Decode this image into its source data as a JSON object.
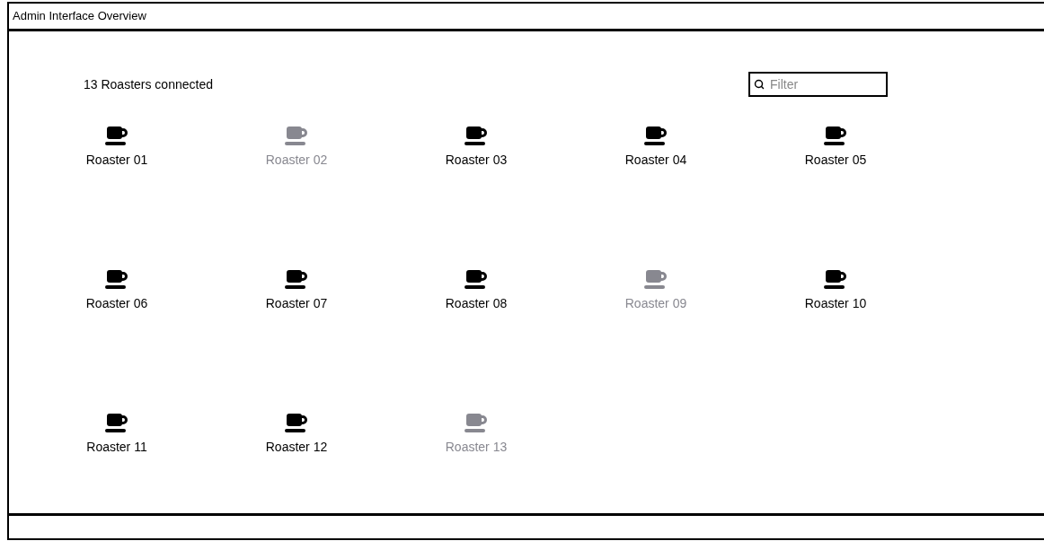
{
  "window": {
    "title": "Admin Interface Overview"
  },
  "summary": "13 Roasters connected",
  "filter": {
    "placeholder": "Filter"
  },
  "roasters": [
    {
      "name": "Roaster 01",
      "disabled": false
    },
    {
      "name": "Roaster 02",
      "disabled": true
    },
    {
      "name": "Roaster 03",
      "disabled": false
    },
    {
      "name": "Roaster 04",
      "disabled": false
    },
    {
      "name": "Roaster 05",
      "disabled": false
    },
    {
      "name": "Roaster 06",
      "disabled": false
    },
    {
      "name": "Roaster 07",
      "disabled": false
    },
    {
      "name": "Roaster 08",
      "disabled": false
    },
    {
      "name": "Roaster 09",
      "disabled": true
    },
    {
      "name": "Roaster 10",
      "disabled": false
    },
    {
      "name": "Roaster 11",
      "disabled": false
    },
    {
      "name": "Roaster 12",
      "disabled": false
    },
    {
      "name": "Roaster 13",
      "disabled": true
    }
  ]
}
